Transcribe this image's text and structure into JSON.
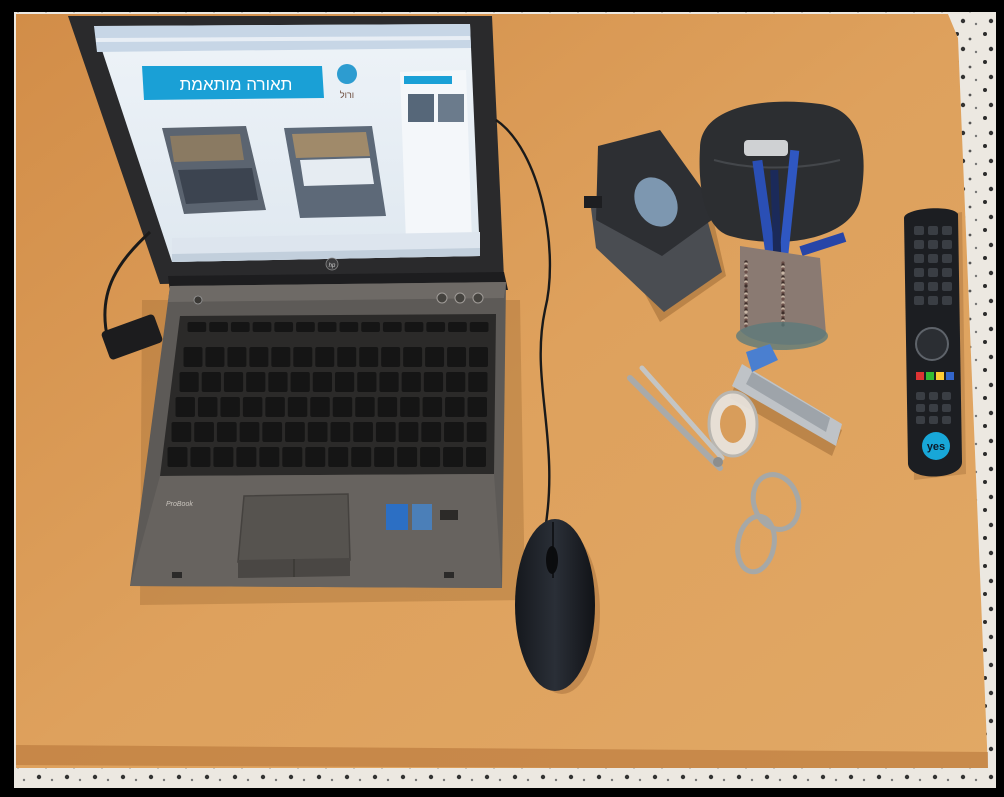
{
  "photo": {
    "screen": {
      "banner_text": "תאורה מותאמת",
      "logo_text": "ורול"
    },
    "laptop": {
      "brand_badge": "hp",
      "model_text": "ProBook"
    },
    "remote": {
      "brand_text": "yes"
    },
    "colors": {
      "table": "#d99a55",
      "floor": "#e9e4dc",
      "laptop_body": "#5d5a57",
      "banner": "#1aa0d6",
      "remote": "#1c1e22"
    }
  }
}
